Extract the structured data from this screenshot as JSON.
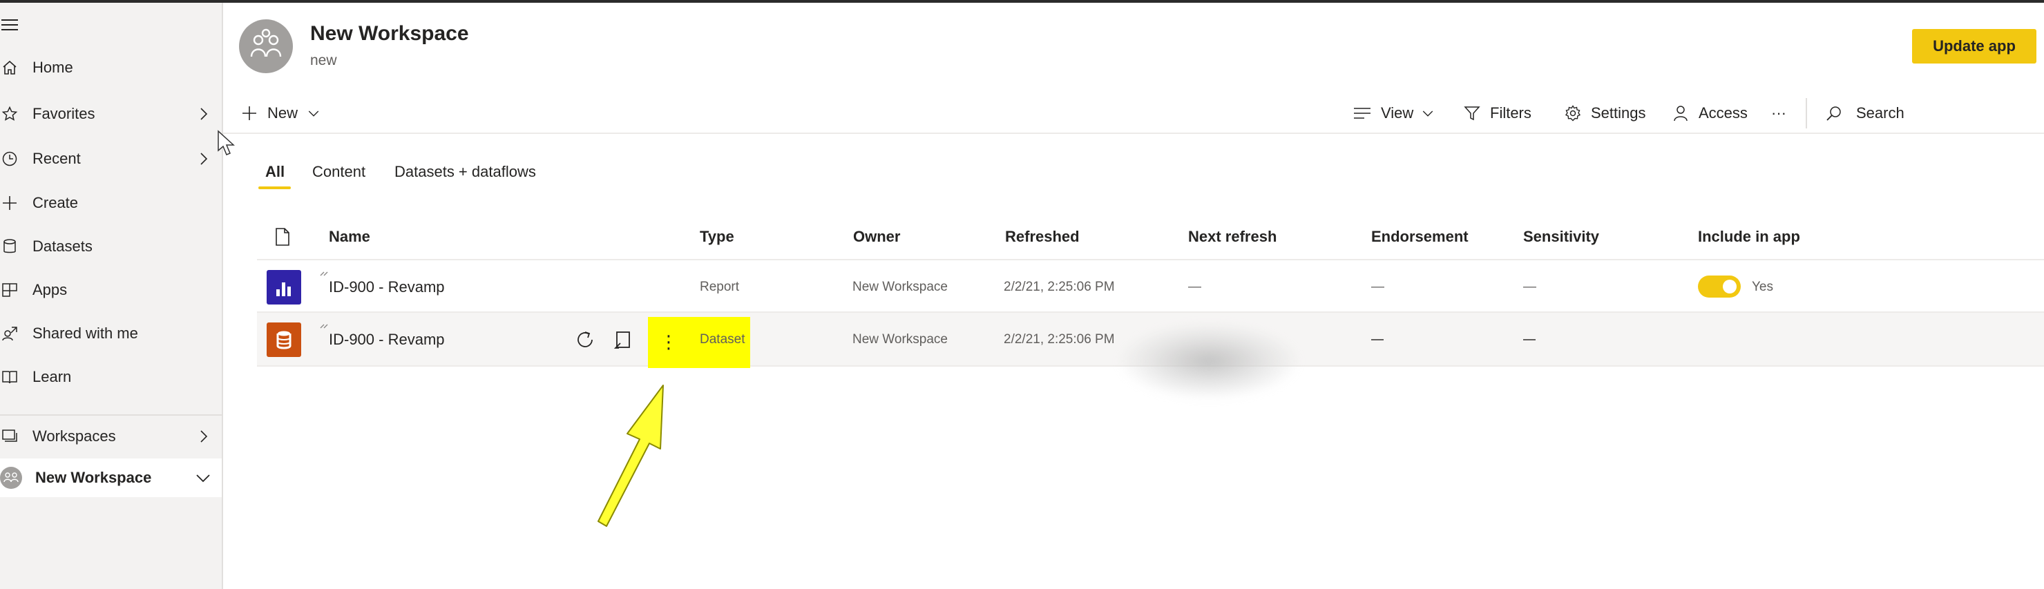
{
  "sidebar": {
    "items": [
      {
        "label": "Home"
      },
      {
        "label": "Favorites"
      },
      {
        "label": "Recent"
      },
      {
        "label": "Create"
      },
      {
        "label": "Datasets"
      },
      {
        "label": "Apps"
      },
      {
        "label": "Shared with me"
      },
      {
        "label": "Learn"
      }
    ],
    "workspaces_label": "Workspaces",
    "current_workspace": "New Workspace"
  },
  "header": {
    "title": "New Workspace",
    "subtitle": "new",
    "update_button": "Update app"
  },
  "toolbar": {
    "new_label": "New",
    "view_label": "View",
    "filters_label": "Filters",
    "settings_label": "Settings",
    "access_label": "Access",
    "more_label": "···",
    "search_label": "Search"
  },
  "tabs": [
    {
      "label": "All",
      "active": true
    },
    {
      "label": "Content",
      "active": false
    },
    {
      "label": "Datasets + dataflows",
      "active": false
    }
  ],
  "table": {
    "columns": [
      "Name",
      "Type",
      "Owner",
      "Refreshed",
      "Next refresh",
      "Endorsement",
      "Sensitivity",
      "Include in app"
    ],
    "rows": [
      {
        "name": "ID-900 - Revamp",
        "type": "Report",
        "owner": "New Workspace",
        "refreshed": "2/2/21, 2:25:06 PM",
        "next_refresh": "—",
        "endorsement": "—",
        "sensitivity": "—",
        "include_in_app": "Yes",
        "icon": "report-icon",
        "icon_color": "#3023a8"
      },
      {
        "name": "ID-900 - Revamp",
        "type": "Dataset",
        "owner": "New Workspace",
        "refreshed": "2/2/21, 2:25:06 PM",
        "next_refresh": "",
        "endorsement": "—",
        "sensitivity": "—",
        "include_in_app": "",
        "icon": "dataset-icon",
        "icon_color": "#ca5010"
      }
    ]
  },
  "colors": {
    "accent": "#f2c811",
    "highlight": "#ffff00",
    "sidebar_bg": "#f3f2f1"
  }
}
